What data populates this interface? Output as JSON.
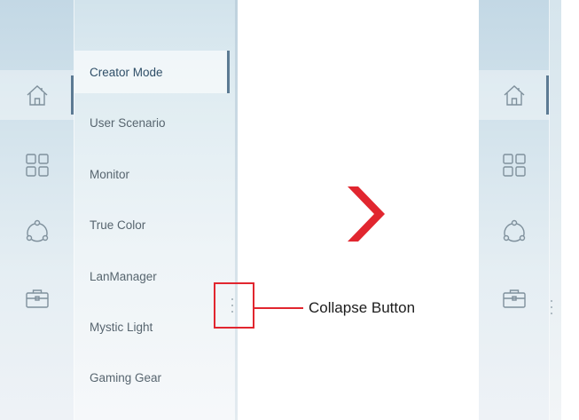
{
  "expanded_panel": {
    "rail_icons": [
      "home-icon",
      "apps-grid-icon",
      "share-nodes-icon",
      "toolbox-icon"
    ],
    "menu_items": [
      {
        "label": "Creator Mode",
        "active": true
      },
      {
        "label": "User Scenario",
        "active": false
      },
      {
        "label": "Monitor",
        "active": false
      },
      {
        "label": "True Color",
        "active": false
      },
      {
        "label": "LanManager",
        "active": false
      },
      {
        "label": "Mystic Light",
        "active": false
      },
      {
        "label": "Gaming Gear",
        "active": false
      }
    ],
    "collapse_button_icon": "vertical-dots-icon"
  },
  "callout": {
    "label": "Collapse Button",
    "color": "#e1262f"
  },
  "arrow": {
    "icon": "chevron-right-icon",
    "color": "#e1262f"
  },
  "collapsed_panel": {
    "rail_icons": [
      "home-icon",
      "apps-grid-icon",
      "share-nodes-icon",
      "toolbox-icon"
    ],
    "expand_button_icon": "vertical-dots-icon"
  },
  "colors": {
    "accent": "#5c7a93",
    "text": "#57656f",
    "highlight": "#e1262f"
  }
}
